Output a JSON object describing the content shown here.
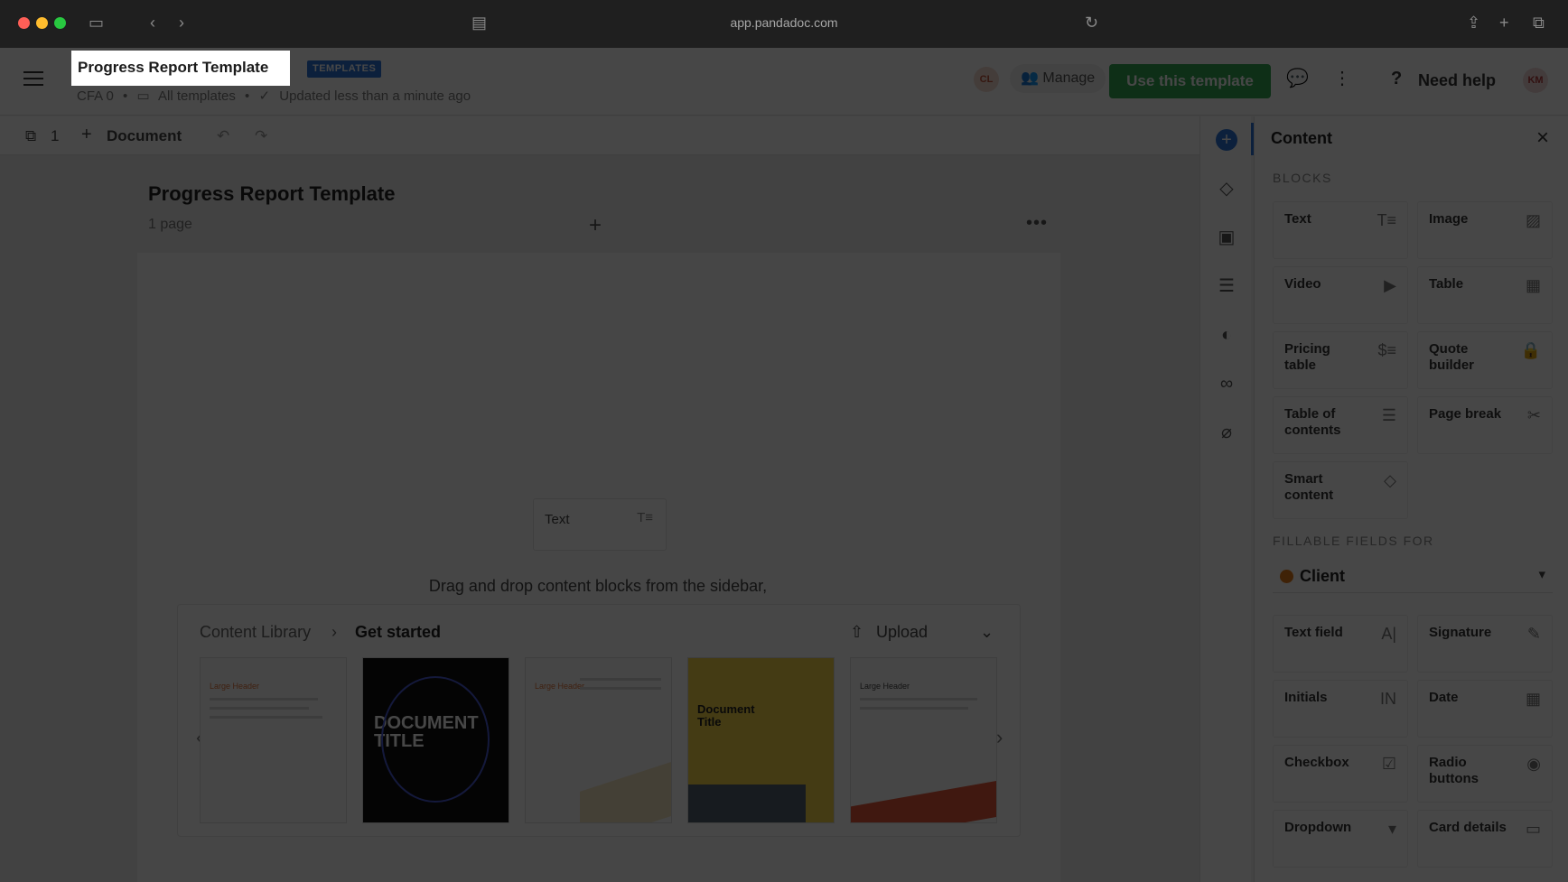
{
  "browser": {
    "url": "app.pandadoc.com"
  },
  "header": {
    "title": "Progress Report Template",
    "badge": "TEMPLATES",
    "workspace": "CFA 0",
    "folder": "All templates",
    "status": "Updated less than a minute ago",
    "avatar_left": "CL",
    "manage_label": "Manage",
    "use_template_label": "Use this template",
    "help_label": "Need help",
    "avatar_right": "KM"
  },
  "toolbar": {
    "page_count": "1",
    "document_label": "Document"
  },
  "canvas": {
    "doc_title": "Progress Report Template",
    "page_count_label": "1 page",
    "text_block_label": "Text",
    "drag_hint": "Drag and drop content blocks from the sidebar,",
    "library": {
      "crumb_root": "Content Library",
      "crumb_current": "Get started",
      "upload_label": "Upload",
      "thumbnails": [
        {
          "title": "Large Header",
          "style": "light"
        },
        {
          "title": "DOCUMENT TITLE",
          "style": "dark"
        },
        {
          "title": "Large Header",
          "style": "light"
        },
        {
          "title": "Document Title",
          "style": "yellow"
        },
        {
          "title": "Large Header",
          "style": "light"
        }
      ]
    }
  },
  "panel": {
    "title": "Content",
    "blocks_heading": "BLOCKS",
    "blocks": [
      {
        "label": "Text",
        "icon": "text-icon"
      },
      {
        "label": "Image",
        "icon": "image-icon"
      },
      {
        "label": "Video",
        "icon": "video-icon"
      },
      {
        "label": "Table",
        "icon": "table-icon"
      },
      {
        "label": "Pricing table",
        "icon": "pricing-icon"
      },
      {
        "label": "Quote builder",
        "icon": "lock-icon"
      },
      {
        "label": "Table of contents",
        "icon": "list-icon"
      },
      {
        "label": "Page break",
        "icon": "scissors-icon"
      },
      {
        "label": "Smart content",
        "icon": "shapes-icon"
      }
    ],
    "fillable_heading": "FILLABLE FIELDS FOR",
    "recipient": "Client",
    "recipient_color": "#e07a1c",
    "fields": [
      {
        "label": "Text field",
        "icon": "text-field-icon"
      },
      {
        "label": "Signature",
        "icon": "pen-icon"
      },
      {
        "label": "Initials",
        "icon": "initials-icon"
      },
      {
        "label": "Date",
        "icon": "calendar-icon"
      },
      {
        "label": "Checkbox",
        "icon": "checkbox-icon"
      },
      {
        "label": "Radio buttons",
        "icon": "radio-icon"
      },
      {
        "label": "Dropdown",
        "icon": "dropdown-icon"
      },
      {
        "label": "Card details",
        "icon": "card-icon"
      }
    ]
  }
}
